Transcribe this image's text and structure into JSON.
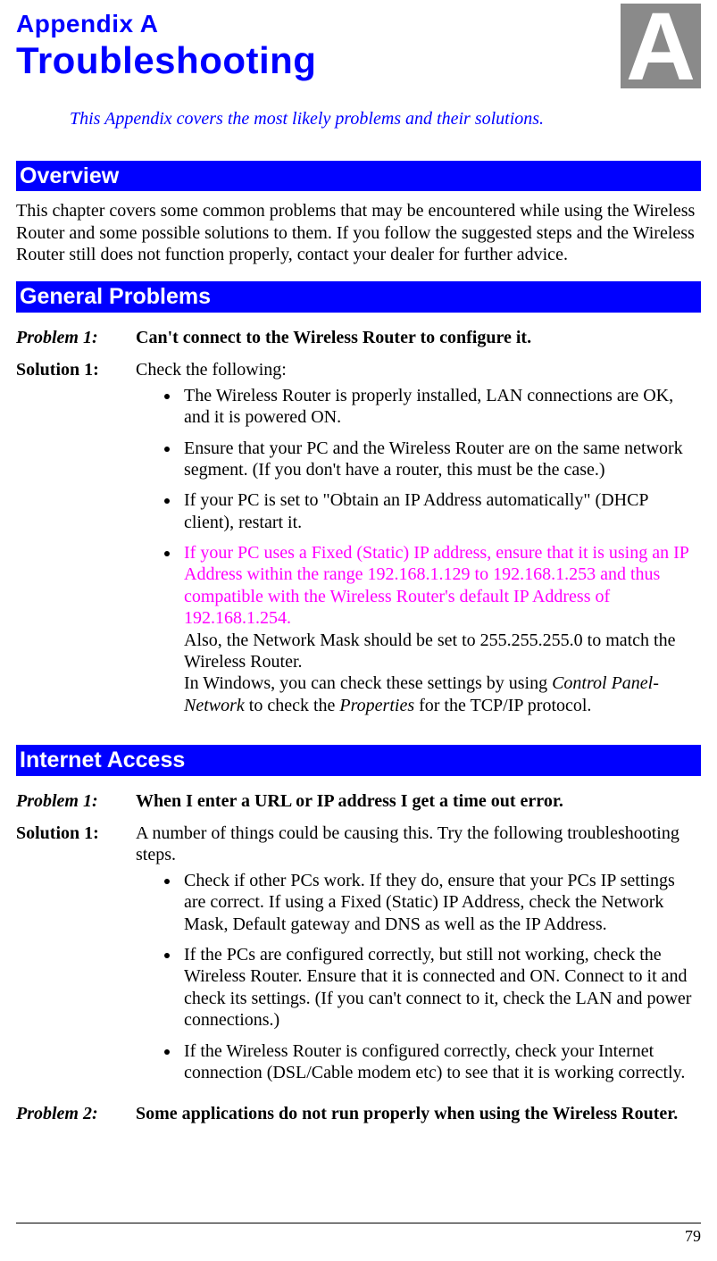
{
  "header": {
    "appendix": "Appendix A",
    "title": "Troubleshooting",
    "big_letter": "A",
    "intro": "This Appendix covers the most likely problems and their solutions."
  },
  "overview": {
    "heading": "Overview",
    "para": "This chapter covers some common problems that may be encountered while using the Wireless Router and some possible solutions to them. If you follow the suggested steps and the Wireless Router still does not function properly, contact your dealer for further advice."
  },
  "general": {
    "heading": "General Problems",
    "p1_label": "Problem 1:",
    "p1_text": "Can't connect to the Wireless Router to configure it.",
    "s1_label": "Solution 1:",
    "s1_intro": "Check the following:",
    "s1_b1": "The Wireless Router is properly installed, LAN connections are OK, and it is powered ON.",
    "s1_b2": "Ensure that your PC and the Wireless Router are on the same network segment. (If you don't have a router, this must be the case.)",
    "s1_b3": "If your PC is set to \"Obtain an IP Address automatically\" (DHCP client), restart it.",
    "s1_b4_mag": "If your PC uses a Fixed (Static) IP address, ensure that it is using an IP Address within the range 192.168.1.129 to 192.168.1.253 and thus compatible with the Wireless Router's default IP Address of 192.168.1.254.",
    "s1_b4_rest1": "Also, the Network Mask should be set to 255.255.255.0 to match the Wireless Router.",
    "s1_b4_rest2a": "In Windows, you can check these settings by using ",
    "s1_b4_ital1": "Control Panel-Network",
    "s1_b4_rest2b": " to check the ",
    "s1_b4_ital2": "Properties",
    "s1_b4_rest2c": " for the TCP/IP protocol."
  },
  "internet": {
    "heading": "Internet Access",
    "p1_label": "Problem 1:",
    "p1_text": "When I enter a URL or IP address I get a time out error.",
    "s1_label": "Solution 1:",
    "s1_intro": "A number of things could be causing this. Try the following troubleshooting steps.",
    "s1_b1": "Check if other PCs work. If they do, ensure that your PCs IP settings are correct. If using a Fixed (Static) IP Address, check the Network Mask, Default gateway and DNS as well as the IP Address.",
    "s1_b2": "If the PCs are configured correctly, but still not working, check the Wireless Router. Ensure that it is connected and ON. Connect to it and check its settings. (If you can't connect to it, check the LAN and power connections.)",
    "s1_b3": "If the Wireless Router is configured correctly, check your Internet connection (DSL/Cable modem etc) to see that it is working correctly.",
    "p2_label": "Problem 2:",
    "p2_text": "Some applications do not run properly when using the Wireless Router."
  },
  "page_number": "79"
}
